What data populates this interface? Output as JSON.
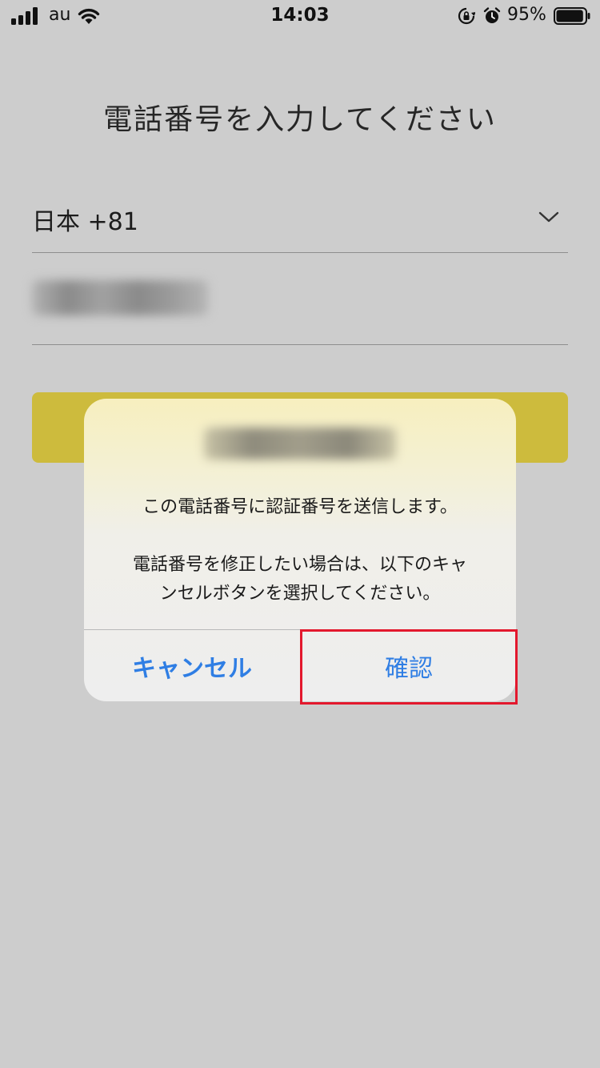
{
  "status_bar": {
    "carrier": "au",
    "time": "14:03",
    "battery_percent": "95%",
    "battery_level": 0.95,
    "icons": [
      "signal-icon",
      "wifi-icon",
      "rotation-lock-icon",
      "alarm-icon",
      "battery-icon"
    ]
  },
  "page": {
    "title": "電話番号を入力してください",
    "country_selector": {
      "label": "日本 +81",
      "icon": "chevron-down-icon"
    },
    "phone_input": {
      "value": "",
      "redacted": true
    },
    "submit_button_color": "#cdbb3d"
  },
  "alert": {
    "title": "",
    "title_redacted": true,
    "message": "この電話番号に認証番号を送信します。\n\n電話番号を修正したい場合は、以下のキャ\nンセルボタンを選択してください。",
    "cancel_label": "キャンセル",
    "confirm_label": "確認",
    "button_color": "#2f7ee4",
    "highlight_color": "#e3182d"
  }
}
